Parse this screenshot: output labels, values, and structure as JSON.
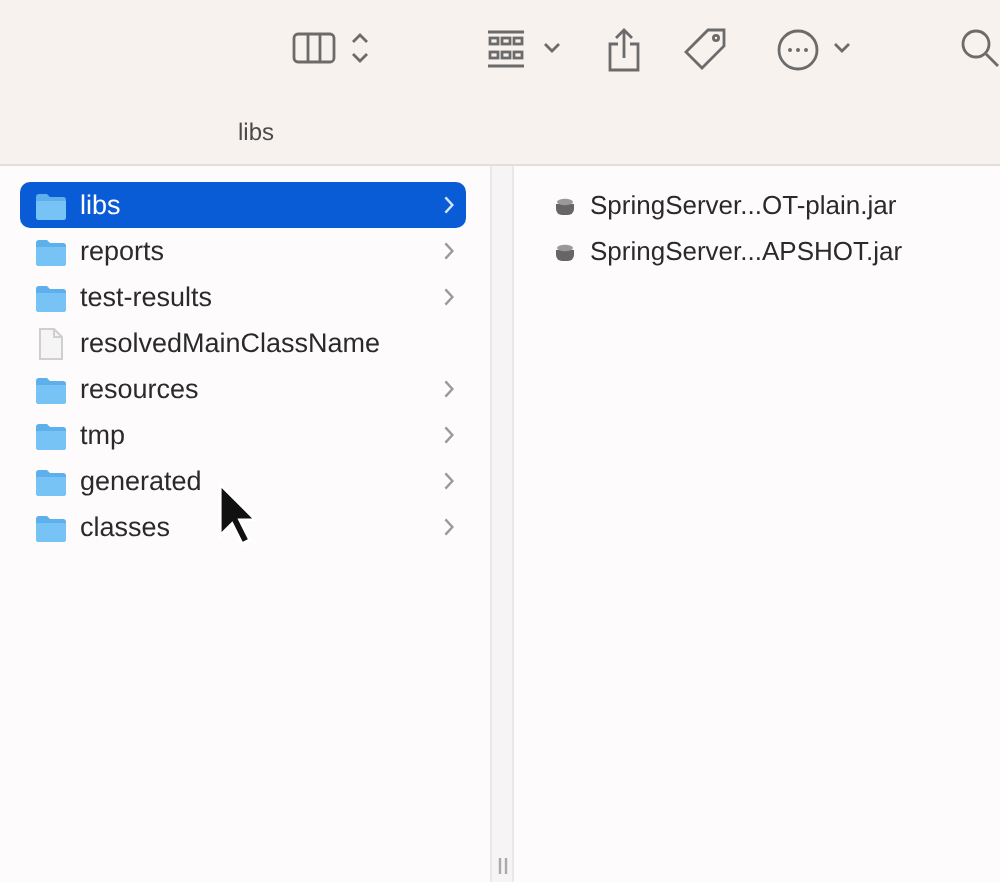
{
  "path_bar": {
    "title": "libs"
  },
  "columns": [
    {
      "items": [
        {
          "name": "libs",
          "kind": "folder",
          "selected": true
        },
        {
          "name": "reports",
          "kind": "folder",
          "selected": false
        },
        {
          "name": "test-results",
          "kind": "folder",
          "selected": false
        },
        {
          "name": "resolvedMainClassName",
          "kind": "file",
          "selected": false
        },
        {
          "name": "resources",
          "kind": "folder",
          "selected": false
        },
        {
          "name": "tmp",
          "kind": "folder",
          "selected": false
        },
        {
          "name": "generated",
          "kind": "folder",
          "selected": false
        },
        {
          "name": "classes",
          "kind": "folder",
          "selected": false
        }
      ]
    },
    {
      "items": [
        {
          "name": "SpringServer...OT-plain.jar",
          "kind": "jar",
          "selected": false
        },
        {
          "name": "SpringServer...APSHOT.jar",
          "kind": "jar",
          "selected": false
        }
      ]
    }
  ]
}
